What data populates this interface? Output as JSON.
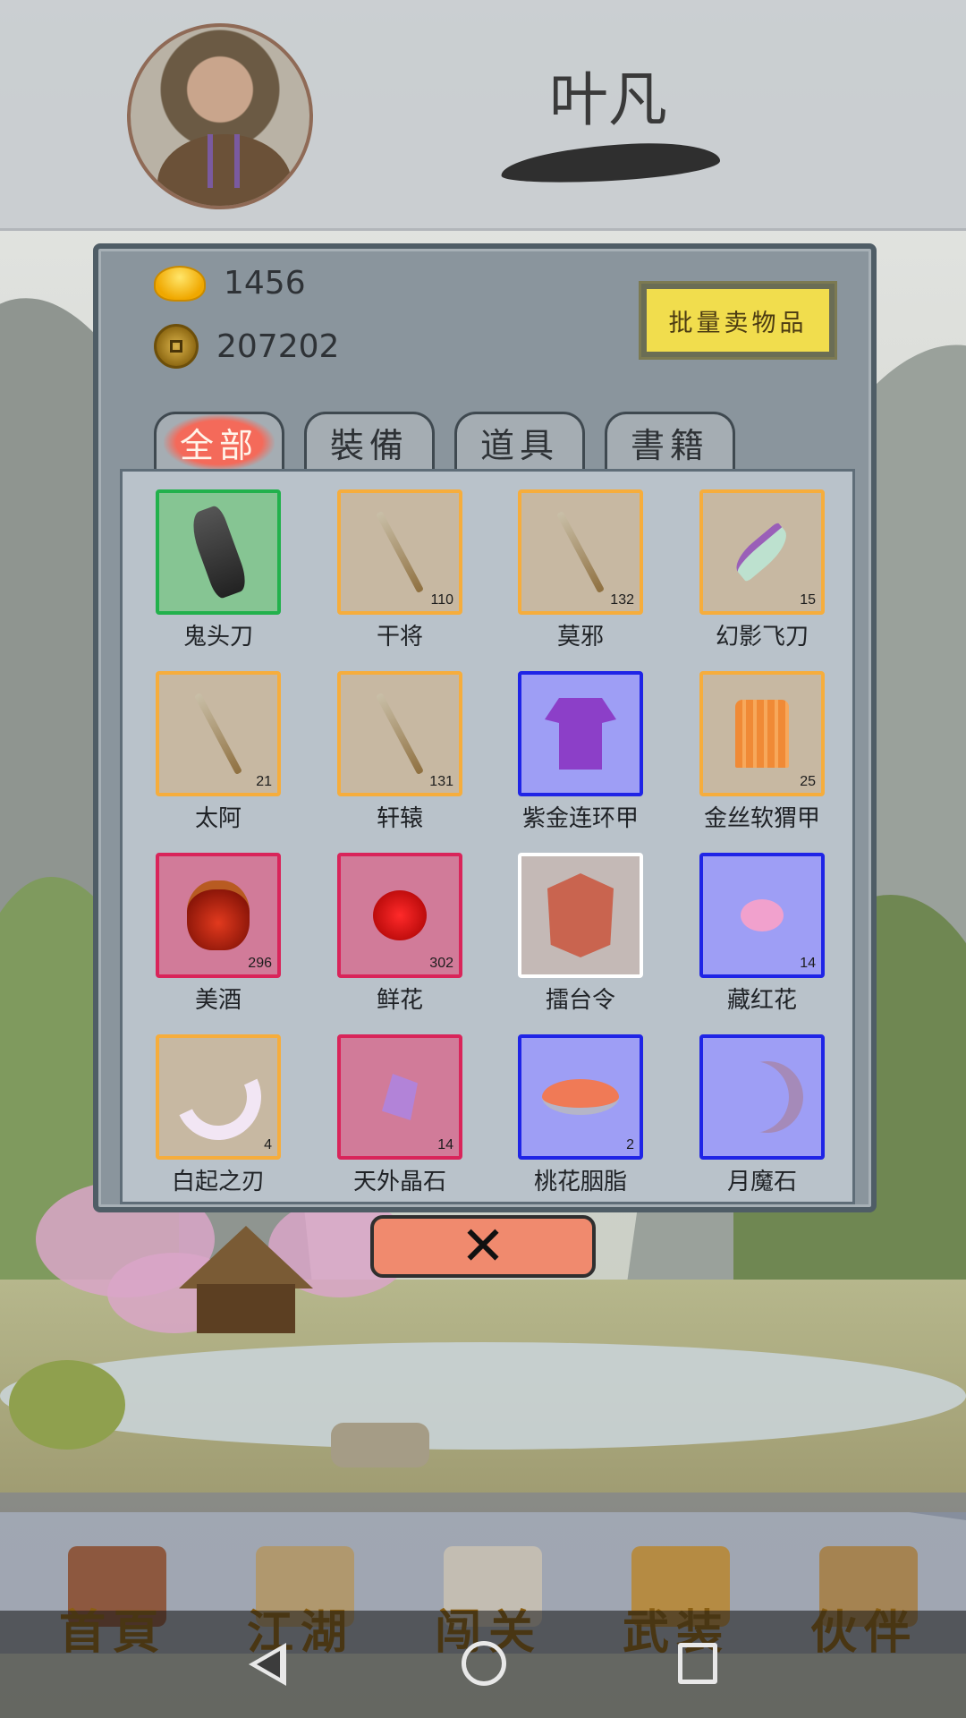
{
  "player": {
    "name": "叶凡"
  },
  "currency": {
    "gold": "1456",
    "coins": "207202"
  },
  "sell_button": "批量卖物品",
  "tabs": [
    {
      "label": "全部",
      "active": true
    },
    {
      "label": "裝備",
      "active": false
    },
    {
      "label": "道具",
      "active": false
    },
    {
      "label": "書籍",
      "active": false
    }
  ],
  "items": [
    {
      "name": "鬼头刀",
      "count": "",
      "quality": "green",
      "icon": "cleaver-icon"
    },
    {
      "name": "干将",
      "count": "110",
      "quality": "orange",
      "icon": "sword-icon"
    },
    {
      "name": "莫邪",
      "count": "132",
      "quality": "orange",
      "icon": "sword-icon"
    },
    {
      "name": "幻影飞刀",
      "count": "15",
      "quality": "orange",
      "icon": "flying-knife-icon"
    },
    {
      "name": "太阿",
      "count": "21",
      "quality": "orange",
      "icon": "sword-icon"
    },
    {
      "name": "轩辕",
      "count": "131",
      "quality": "orange",
      "icon": "sword-icon"
    },
    {
      "name": "紫金连环甲",
      "count": "",
      "quality": "blue",
      "icon": "armor-robe-icon"
    },
    {
      "name": "金丝软猬甲",
      "count": "25",
      "quality": "orange",
      "icon": "vest-icon"
    },
    {
      "name": "美酒",
      "count": "296",
      "quality": "red",
      "icon": "wine-jar-icon"
    },
    {
      "name": "鲜花",
      "count": "302",
      "quality": "red",
      "icon": "rose-icon"
    },
    {
      "name": "擂台令",
      "count": "",
      "quality": "white",
      "icon": "token-icon"
    },
    {
      "name": "藏红花",
      "count": "14",
      "quality": "blue",
      "icon": "flower-icon"
    },
    {
      "name": "白起之刃",
      "count": "4",
      "quality": "orange",
      "icon": "curved-blade-icon"
    },
    {
      "name": "天外晶石",
      "count": "14",
      "quality": "red",
      "icon": "crystal-icon"
    },
    {
      "name": "桃花胭脂",
      "count": "2",
      "quality": "blue",
      "icon": "rouge-icon"
    },
    {
      "name": "月魔石",
      "count": "",
      "quality": "blue",
      "icon": "moon-stone-icon"
    }
  ],
  "close_button": "✕",
  "bottom_nav": [
    {
      "label": "首頁",
      "icon": "house-icon"
    },
    {
      "label": "江湖",
      "icon": "scroll-icon"
    },
    {
      "label": "闯关",
      "icon": "crossed-swords-icon"
    },
    {
      "label": "武装",
      "icon": "armor-icon"
    },
    {
      "label": "伙伴",
      "icon": "partners-icon"
    }
  ],
  "quality_colors": {
    "green": "#22b14c",
    "orange": "#f6ad3c",
    "blue": "#1f24e6",
    "red": "#d9245a",
    "white": "#ffffff"
  }
}
